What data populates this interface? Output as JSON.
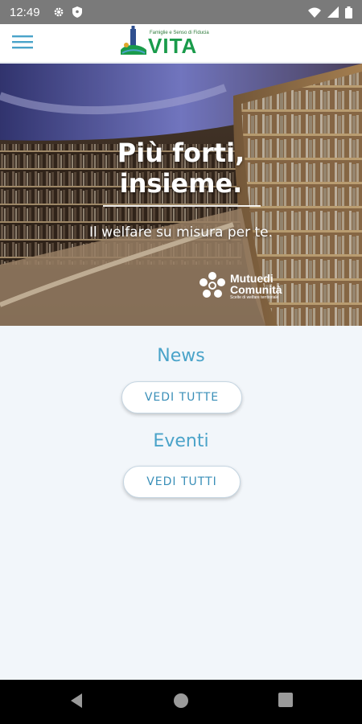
{
  "status_bar": {
    "time": "12:49"
  },
  "app_bar": {
    "logo": {
      "tagline": "Famiglie e Senso di Fiducia",
      "name": "VITA"
    }
  },
  "hero": {
    "title_line1": "Più forti,",
    "title_line2": "insieme.",
    "subtitle": "Il welfare su misura per te.",
    "partner": {
      "name_line1": "Mutuedi",
      "name_line2": "Comunità",
      "tagline": "Scelte di welfare territoriale"
    }
  },
  "sections": {
    "news": {
      "title": "News",
      "button_label": "VEDI TUTTE"
    },
    "events": {
      "title": "Eventi",
      "button_label": "VEDI TUTTI"
    }
  },
  "colors": {
    "accent": "#4aa3c9",
    "brand_green": "#1a9b4b",
    "status_bar": "#7a7a7a"
  }
}
